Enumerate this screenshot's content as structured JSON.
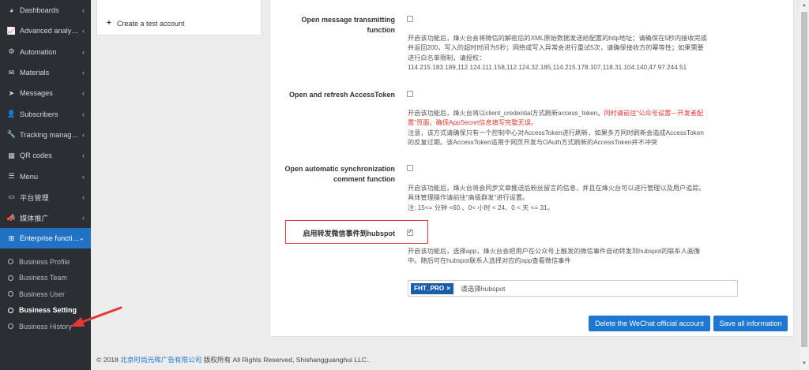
{
  "sidebar": {
    "items": [
      {
        "label": "Dashboards",
        "icon": "dashboard-icon",
        "glyph": "◕"
      },
      {
        "label": "Advanced analyt…",
        "icon": "chart-icon",
        "glyph": "📈"
      },
      {
        "label": "Automation",
        "icon": "gear-icon",
        "glyph": "⚙"
      },
      {
        "label": "Materials",
        "icon": "envelope-icon",
        "glyph": "✉"
      },
      {
        "label": "Messages",
        "icon": "send-icon",
        "glyph": "➤"
      },
      {
        "label": "Subscribers",
        "icon": "user-icon",
        "glyph": "👤"
      },
      {
        "label": "Tracking manag…",
        "icon": "wrench-icon",
        "glyph": "🔧"
      },
      {
        "label": "QR codes",
        "icon": "qrcode-icon",
        "glyph": "▦"
      },
      {
        "label": "Menu",
        "icon": "menu-icon",
        "glyph": "☰"
      },
      {
        "label": "平台管理",
        "icon": "monitor-icon",
        "glyph": "▭"
      },
      {
        "label": "媒体推广",
        "icon": "megaphone-icon",
        "glyph": "📣"
      }
    ],
    "active_item": {
      "label": "Enterprise functi…",
      "icon": "grid-icon",
      "glyph": "⊞"
    },
    "sub_items": [
      {
        "label": "Business Profile"
      },
      {
        "label": "Business Team"
      },
      {
        "label": "Business User"
      },
      {
        "label": "Business Setting"
      },
      {
        "label": "Business History"
      }
    ]
  },
  "left_panel": {
    "create_label": "Create a test account"
  },
  "settings": {
    "msg_transmit": {
      "label_line1": "Open message transmitting",
      "label_line2": "function",
      "checked": false,
      "desc_line1": "开启该功能后，烽火台会将微信的解密后的XML原始数据发送给配置的http地址；请确保在5秒内接收完成",
      "desc_line2": "并返回200，写入的超时时间为5秒；网络或写入异常会进行重试5次，请确保接收方的幂等性；如果需要",
      "desc_line3": "进行白名单限制，请授权：",
      "desc_line4": "114.215.183.189,112.124.111.158,112.124.32.185,114.215.178.107,118.31.104.140,47.97.244.51"
    },
    "access_token": {
      "label": "Open and refresh AccessToken",
      "checked": false,
      "desc_line1_a": "开启该功能后，烽火台将以client_credential方式刷新access_token。",
      "desc_line1_b": "同时请前往\"公众号设置—开发者配",
      "desc_line2_a": "置\"页面，确保AppSecret信息填写完整无误。",
      "desc_line3": "注意，该方式请确保只有一个控制中心对AccessToken进行刷新，如果多方同时刷新会造成AccessToken",
      "desc_line4": "的反复过期。该AccessToken适用于网页开发与OAuth方式刷新的AccessToken并不冲突"
    },
    "auto_sync": {
      "label_line1": "Open automatic synchronization",
      "label_line2": "comment function",
      "checked": false,
      "desc_line1": "开启该功能后，烽火台将会同步文章推送后粉丝留言的信息，并且在烽火台可以进行管理以及用户追踪。",
      "desc_line2": "具体管理操作请前往\"高级群发\"进行设置。",
      "desc_line3": "注: 15<= 分钟 <60 、0< 小时 < 24、0 < 天 <= 31。"
    },
    "hubspot": {
      "label": "启用转发微信事件到hubspot",
      "checked": true,
      "desc_line1": "开启该功能后，选择app，烽火台会把用户在公众号上触发的微信事件自动转发到hubspot的联系人画像",
      "desc_line2": "中。随后可在hubspot联系人选择对应的app查看微信事件",
      "tag_label": "FHT_PRO",
      "tag_remove": "×",
      "placeholder": "请选择hubspot"
    }
  },
  "buttons": {
    "delete_label": "Delete the WeChat official account",
    "save_label": "Save all information"
  },
  "footer": {
    "prefix": "© 2018",
    "company": "北京时尚光晖广告有限公司",
    "suffix": "版权所有 All Rights Reserved, Shishangguanghui LLC.."
  },
  "colors": {
    "sidebar_bg": "#2b2e33",
    "active_blue": "#1f72c4",
    "button_blue": "#1e78d2",
    "highlight_red": "#e53935"
  }
}
